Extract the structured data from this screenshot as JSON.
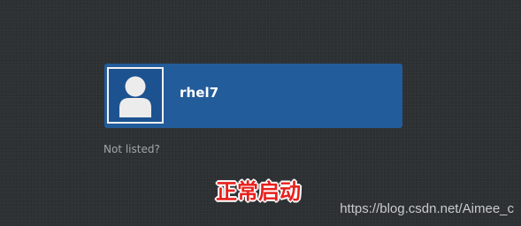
{
  "login": {
    "users": [
      {
        "name": "rhel7",
        "avatar_icon": "default-user-icon",
        "selected": true
      }
    ],
    "not_listed_label": "Not listed?"
  },
  "annotation": {
    "text": "正常启动",
    "color": "#e8201c"
  },
  "watermark": {
    "text": "https://blog.csdn.net/Aimee_c"
  },
  "colors": {
    "background": "#2e3133",
    "card": "#235c9a",
    "card_text": "#ffffff",
    "muted_link": "#a3a6a8"
  }
}
